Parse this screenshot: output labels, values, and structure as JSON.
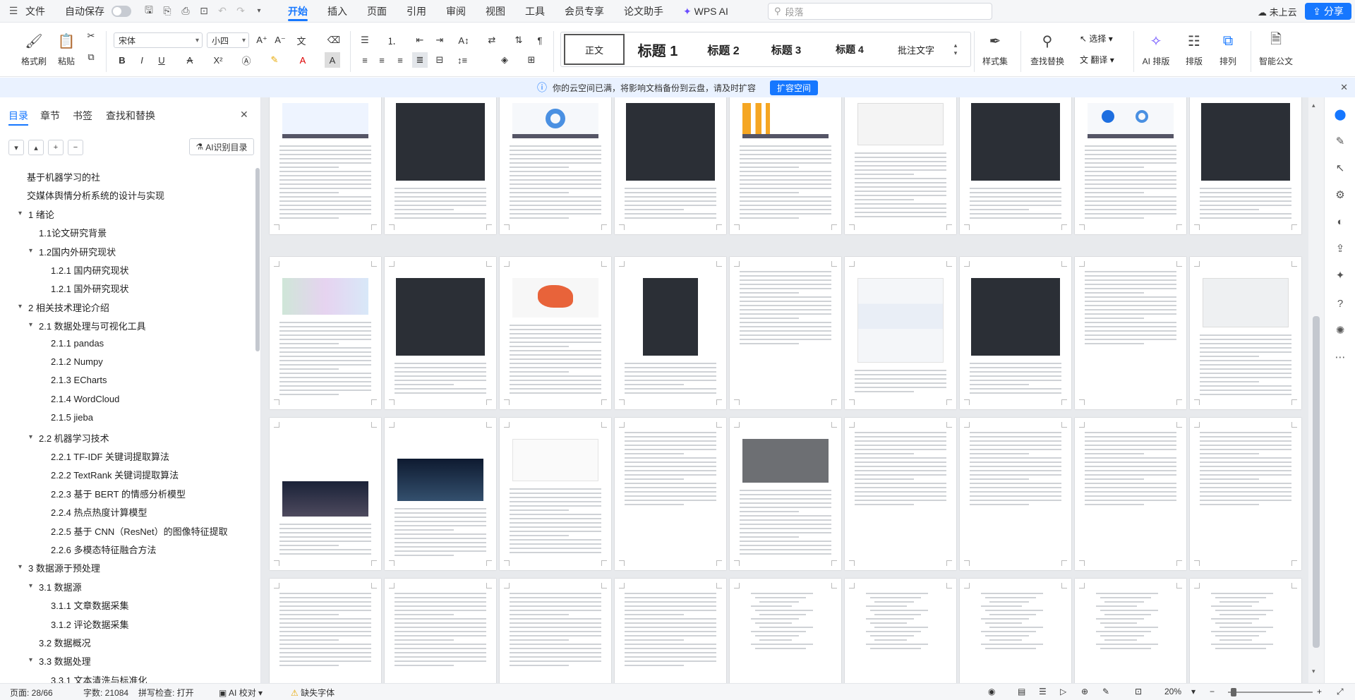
{
  "menubar": {
    "file": "文件",
    "autosave": "自动保存",
    "tabs": [
      "开始",
      "插入",
      "页面",
      "引用",
      "审阅",
      "视图",
      "工具",
      "会员专享",
      "论文助手",
      "WPS AI"
    ],
    "active_tab": "开始",
    "search_placeholder": "段落",
    "cloud": "未上云",
    "share": "分享"
  },
  "ribbon": {
    "format_painter": "格式刷",
    "paste": "粘贴",
    "font_name": "宋体",
    "font_size": "小四",
    "styles": [
      "正文",
      "标题 1",
      "标题 2",
      "标题 3",
      "标题 4",
      "批注文字"
    ],
    "style_set": "样式集",
    "find_replace": "查找替换",
    "select": "选择",
    "translate": "翻译",
    "ai_layout": "AI 排版",
    "layout": "排版",
    "arrange": "排列",
    "smart_formula": "智能公文"
  },
  "notice": {
    "text": "你的云空间已满，将影响文档备份到云盘，请及时扩容",
    "button": "扩容空间"
  },
  "sidebar": {
    "tabs": [
      "目录",
      "章节",
      "书签",
      "查找和替换"
    ],
    "ai_toc": "AI识别目录",
    "toc": [
      {
        "label": "基于机器学习的社",
        "level": 0
      },
      {
        "label": "交媒体舆情分析系统的设计与实现",
        "level": 0
      },
      {
        "label": "1 绪论",
        "level": 1,
        "caret": true
      },
      {
        "label": "1.1论文研究背景",
        "level": 2
      },
      {
        "label": "1.2国内外研究现状",
        "level": 2,
        "caret": true
      },
      {
        "label": "1.2.1  国内研究现状",
        "level": 3
      },
      {
        "label": "1.2.1  国外研究现状",
        "level": 3
      },
      {
        "label": "2 相关技术理论介绍",
        "level": 1,
        "caret": true
      },
      {
        "label": "2.1  数据处理与可视化工具",
        "level": 2,
        "caret": true
      },
      {
        "label": "2.1.1 pandas",
        "level": 3
      },
      {
        "label": "2.1.2 Numpy",
        "level": 3
      },
      {
        "label": "2.1.3 ECharts",
        "level": 3
      },
      {
        "label": "2.1.4 WordCloud",
        "level": 3
      },
      {
        "label": "2.1.5 jieba",
        "level": 3
      },
      {
        "label": "2.2  机器学习技术",
        "level": 2,
        "caret": true
      },
      {
        "label": "2.2.1 TF-IDF  关键词提取算法",
        "level": 3
      },
      {
        "label": "2.2.2 TextRank  关键词提取算法",
        "level": 3
      },
      {
        "label": "2.2.3  基于  BERT 的情感分析模型",
        "level": 3
      },
      {
        "label": "2.2.4  热点热度计算模型",
        "level": 3
      },
      {
        "label": "2.2.5  基于  CNN（ResNet）的图像特征提取",
        "level": 3
      },
      {
        "label": "2.2.6  多模态特征融合方法",
        "level": 3
      },
      {
        "label": "3  数据源于预处理",
        "level": 1,
        "caret": true
      },
      {
        "label": "3.1 数据源",
        "level": 2,
        "caret": true
      },
      {
        "label": "3.1.1  文章数据采集",
        "level": 3
      },
      {
        "label": "3.1.2  评论数据采集",
        "level": 3
      },
      {
        "label": "3.2 数据概况",
        "level": 2
      },
      {
        "label": "3.3  数据处理",
        "level": 2,
        "caret": true
      },
      {
        "label": "3.3.1  文本清洗与标准化",
        "level": 3
      }
    ]
  },
  "status": {
    "page": "页面: 28/66",
    "words": "字数: 21084",
    "spell": "拼写检查: 打开",
    "ai_check": "AI 校对",
    "missing_font": "缺失字体",
    "zoom": "20%"
  },
  "colors": {
    "accent": "#1677ff",
    "dark_code": "#2b2f36"
  }
}
